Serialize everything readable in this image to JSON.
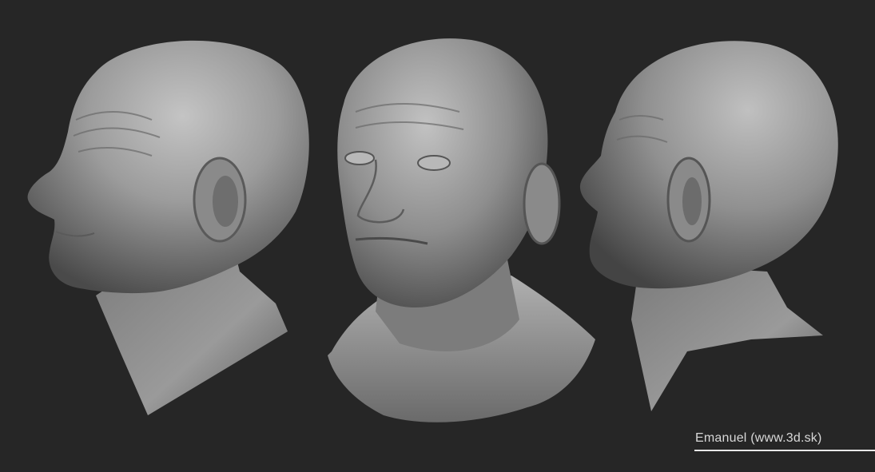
{
  "scene": {
    "background_color": "#262626",
    "material_color": "#9a9a9a",
    "views": [
      {
        "name": "left-profile"
      },
      {
        "name": "three-quarter-front"
      },
      {
        "name": "right-back-three-quarter"
      }
    ]
  },
  "credit": {
    "text": "Emanuel (www.3d.sk)",
    "color": "#d8d8d8"
  }
}
